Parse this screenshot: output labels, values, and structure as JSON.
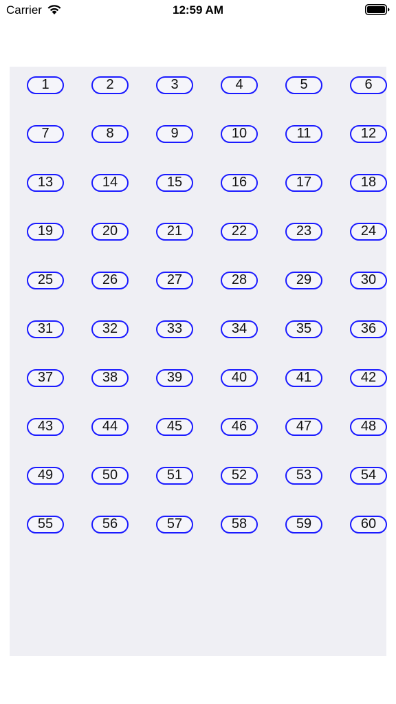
{
  "status_bar": {
    "carrier": "Carrier",
    "time": "12:59 AM",
    "wifi_icon": "wifi-icon",
    "battery_icon": "battery-full-icon"
  },
  "colors": {
    "pill_border": "#1a1aff",
    "panel_background": "#efeff4"
  },
  "buttons": [
    "1",
    "2",
    "3",
    "4",
    "5",
    "6",
    "7",
    "8",
    "9",
    "10",
    "11",
    "12",
    "13",
    "14",
    "15",
    "16",
    "17",
    "18",
    "19",
    "20",
    "21",
    "22",
    "23",
    "24",
    "25",
    "26",
    "27",
    "28",
    "29",
    "30",
    "31",
    "32",
    "33",
    "34",
    "35",
    "36",
    "37",
    "38",
    "39",
    "40",
    "41",
    "42",
    "43",
    "44",
    "45",
    "46",
    "47",
    "48",
    "49",
    "50",
    "51",
    "52",
    "53",
    "54",
    "55",
    "56",
    "57",
    "58",
    "59",
    "60"
  ]
}
